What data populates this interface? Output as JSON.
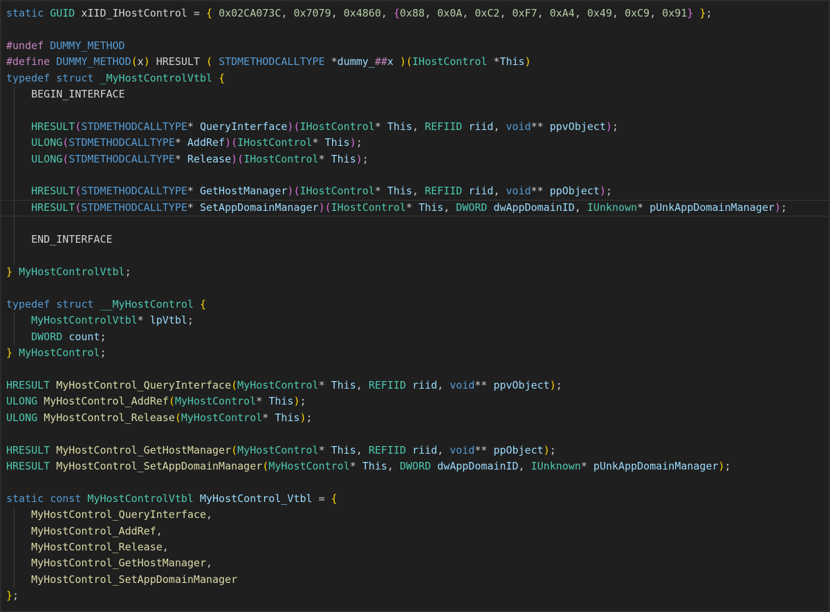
{
  "editor": {
    "theme": "dark",
    "colors": {
      "background": "#1f1f1f",
      "keyword": "#569cd6",
      "preprocessor": "#c586c0",
      "type": "#4ec9b0",
      "function": "#dcdcaa",
      "number": "#b5cea8",
      "variable": "#9cdcfe",
      "bracket_1": "#ffd700",
      "bracket_2": "#da70d6",
      "bracket_3": "#179fff"
    },
    "current_line": 12,
    "lines": [
      [
        [
          "kw",
          "static"
        ],
        [
          "p",
          " "
        ],
        [
          "type",
          "GUID"
        ],
        [
          "p",
          " "
        ],
        [
          "id",
          "xIID_IHostControl"
        ],
        [
          "p",
          " = "
        ],
        [
          "b1",
          "{"
        ],
        [
          "p",
          " "
        ],
        [
          "num",
          "0x02CA073C"
        ],
        [
          "p",
          ", "
        ],
        [
          "num",
          "0x7079"
        ],
        [
          "p",
          ", "
        ],
        [
          "num",
          "0x4860"
        ],
        [
          "p",
          ", "
        ],
        [
          "b2",
          "{"
        ],
        [
          "num",
          "0x88"
        ],
        [
          "p",
          ", "
        ],
        [
          "num",
          "0x0A"
        ],
        [
          "p",
          ", "
        ],
        [
          "num",
          "0xC2"
        ],
        [
          "p",
          ", "
        ],
        [
          "num",
          "0xF7"
        ],
        [
          "p",
          ", "
        ],
        [
          "num",
          "0xA4"
        ],
        [
          "p",
          ", "
        ],
        [
          "num",
          "0x49"
        ],
        [
          "p",
          ", "
        ],
        [
          "num",
          "0xC9"
        ],
        [
          "p",
          ", "
        ],
        [
          "num",
          "0x91"
        ],
        [
          "b2",
          "}"
        ],
        [
          "p",
          " "
        ],
        [
          "b1",
          "}"
        ],
        [
          "p",
          ";"
        ]
      ],
      [],
      [
        [
          "pre",
          "#undef"
        ],
        [
          "p",
          " "
        ],
        [
          "macro",
          "DUMMY_METHOD"
        ]
      ],
      [
        [
          "pre",
          "#define"
        ],
        [
          "p",
          " "
        ],
        [
          "macro",
          "DUMMY_METHOD"
        ],
        [
          "b1",
          "("
        ],
        [
          "id",
          "x"
        ],
        [
          "b1",
          ")"
        ],
        [
          "p",
          " "
        ],
        [
          "id",
          "HRESULT"
        ],
        [
          "p",
          " "
        ],
        [
          "b1",
          "("
        ],
        [
          "p",
          " "
        ],
        [
          "macro",
          "STDMETHODCALLTYPE"
        ],
        [
          "p",
          " *"
        ],
        [
          "var",
          "dummy_"
        ],
        [
          "pre",
          "##"
        ],
        [
          "var",
          "x"
        ],
        [
          "p",
          " "
        ],
        [
          "b1",
          ")"
        ],
        [
          "b1",
          "("
        ],
        [
          "type",
          "IHostControl"
        ],
        [
          "p",
          " *"
        ],
        [
          "var",
          "This"
        ],
        [
          "b1",
          ")"
        ]
      ],
      [
        [
          "kw",
          "typedef"
        ],
        [
          "p",
          " "
        ],
        [
          "kw",
          "struct"
        ],
        [
          "p",
          " "
        ],
        [
          "type",
          "_MyHostControlVtbl"
        ],
        [
          "p",
          " "
        ],
        [
          "b1",
          "{"
        ]
      ],
      [
        [
          "p",
          "    "
        ],
        [
          "id",
          "BEGIN_INTERFACE"
        ]
      ],
      [],
      [
        [
          "p",
          "    "
        ],
        [
          "type",
          "HRESULT"
        ],
        [
          "b2",
          "("
        ],
        [
          "macro",
          "STDMETHODCALLTYPE"
        ],
        [
          "p",
          "* "
        ],
        [
          "var",
          "QueryInterface"
        ],
        [
          "b2",
          ")"
        ],
        [
          "b2",
          "("
        ],
        [
          "type",
          "IHostControl"
        ],
        [
          "p",
          "* "
        ],
        [
          "var",
          "This"
        ],
        [
          "p",
          ", "
        ],
        [
          "type",
          "REFIID"
        ],
        [
          "p",
          " "
        ],
        [
          "var",
          "riid"
        ],
        [
          "p",
          ", "
        ],
        [
          "kw",
          "void"
        ],
        [
          "p",
          "** "
        ],
        [
          "var",
          "ppvObject"
        ],
        [
          "b2",
          ")"
        ],
        [
          "p",
          ";"
        ]
      ],
      [
        [
          "p",
          "    "
        ],
        [
          "type",
          "ULONG"
        ],
        [
          "b2",
          "("
        ],
        [
          "macro",
          "STDMETHODCALLTYPE"
        ],
        [
          "p",
          "* "
        ],
        [
          "var",
          "AddRef"
        ],
        [
          "b2",
          ")"
        ],
        [
          "b2",
          "("
        ],
        [
          "type",
          "IHostControl"
        ],
        [
          "p",
          "* "
        ],
        [
          "var",
          "This"
        ],
        [
          "b2",
          ")"
        ],
        [
          "p",
          ";"
        ]
      ],
      [
        [
          "p",
          "    "
        ],
        [
          "type",
          "ULONG"
        ],
        [
          "b2",
          "("
        ],
        [
          "macro",
          "STDMETHODCALLTYPE"
        ],
        [
          "p",
          "* "
        ],
        [
          "var",
          "Release"
        ],
        [
          "b2",
          ")"
        ],
        [
          "b2",
          "("
        ],
        [
          "type",
          "IHostControl"
        ],
        [
          "p",
          "* "
        ],
        [
          "var",
          "This"
        ],
        [
          "b2",
          ")"
        ],
        [
          "p",
          ";"
        ]
      ],
      [],
      [
        [
          "p",
          "    "
        ],
        [
          "type",
          "HRESULT"
        ],
        [
          "b2",
          "("
        ],
        [
          "macro",
          "STDMETHODCALLTYPE"
        ],
        [
          "p",
          "* "
        ],
        [
          "var",
          "GetHostManager"
        ],
        [
          "b2",
          ")"
        ],
        [
          "b2",
          "("
        ],
        [
          "type",
          "IHostControl"
        ],
        [
          "p",
          "* "
        ],
        [
          "var",
          "This"
        ],
        [
          "p",
          ", "
        ],
        [
          "type",
          "REFIID"
        ],
        [
          "p",
          " "
        ],
        [
          "var",
          "riid"
        ],
        [
          "p",
          ", "
        ],
        [
          "kw",
          "void"
        ],
        [
          "p",
          "** "
        ],
        [
          "var",
          "ppObject"
        ],
        [
          "b2",
          ")"
        ],
        [
          "p",
          ";"
        ]
      ],
      [
        [
          "p",
          "    "
        ],
        [
          "type",
          "HRESULT"
        ],
        [
          "b2",
          "("
        ],
        [
          "macro",
          "STDMETHODCALLTYPE"
        ],
        [
          "p",
          "* "
        ],
        [
          "var",
          "SetAppDomainManager"
        ],
        [
          "b2",
          ")"
        ],
        [
          "b2",
          "("
        ],
        [
          "type",
          "IHostControl"
        ],
        [
          "p",
          "* "
        ],
        [
          "var",
          "This"
        ],
        [
          "p",
          ", "
        ],
        [
          "type",
          "DWORD"
        ],
        [
          "p",
          " "
        ],
        [
          "var",
          "dwAppDomainID"
        ],
        [
          "p",
          ", "
        ],
        [
          "type",
          "IUnknown"
        ],
        [
          "p",
          "* "
        ],
        [
          "var",
          "pUnkAppDomainManager"
        ],
        [
          "b2",
          ")"
        ],
        [
          "p",
          ";"
        ]
      ],
      [],
      [
        [
          "p",
          "    "
        ],
        [
          "id",
          "END_INTERFACE"
        ]
      ],
      [],
      [
        [
          "b1",
          "}"
        ],
        [
          "p",
          " "
        ],
        [
          "type",
          "MyHostControlVtbl"
        ],
        [
          "p",
          ";"
        ]
      ],
      [],
      [
        [
          "kw",
          "typedef"
        ],
        [
          "p",
          " "
        ],
        [
          "kw",
          "struct"
        ],
        [
          "p",
          " "
        ],
        [
          "type",
          "__MyHostControl"
        ],
        [
          "p",
          " "
        ],
        [
          "b1",
          "{"
        ]
      ],
      [
        [
          "p",
          "    "
        ],
        [
          "type",
          "MyHostControlVtbl"
        ],
        [
          "p",
          "* "
        ],
        [
          "var",
          "lpVtbl"
        ],
        [
          "p",
          ";"
        ]
      ],
      [
        [
          "p",
          "    "
        ],
        [
          "type",
          "DWORD"
        ],
        [
          "p",
          " "
        ],
        [
          "var",
          "count"
        ],
        [
          "p",
          ";"
        ]
      ],
      [
        [
          "b1",
          "}"
        ],
        [
          "p",
          " "
        ],
        [
          "type",
          "MyHostControl"
        ],
        [
          "p",
          ";"
        ]
      ],
      [],
      [
        [
          "type",
          "HRESULT"
        ],
        [
          "p",
          " "
        ],
        [
          "fn",
          "MyHostControl_QueryInterface"
        ],
        [
          "b1",
          "("
        ],
        [
          "type",
          "MyHostControl"
        ],
        [
          "p",
          "* "
        ],
        [
          "var",
          "This"
        ],
        [
          "p",
          ", "
        ],
        [
          "type",
          "REFIID"
        ],
        [
          "p",
          " "
        ],
        [
          "var",
          "riid"
        ],
        [
          "p",
          ", "
        ],
        [
          "kw",
          "void"
        ],
        [
          "p",
          "** "
        ],
        [
          "var",
          "ppvObject"
        ],
        [
          "b1",
          ")"
        ],
        [
          "p",
          ";"
        ]
      ],
      [
        [
          "type",
          "ULONG"
        ],
        [
          "p",
          " "
        ],
        [
          "fn",
          "MyHostControl_AddRef"
        ],
        [
          "b1",
          "("
        ],
        [
          "type",
          "MyHostControl"
        ],
        [
          "p",
          "* "
        ],
        [
          "var",
          "This"
        ],
        [
          "b1",
          ")"
        ],
        [
          "p",
          ";"
        ]
      ],
      [
        [
          "type",
          "ULONG"
        ],
        [
          "p",
          " "
        ],
        [
          "fn",
          "MyHostControl_Release"
        ],
        [
          "b1",
          "("
        ],
        [
          "type",
          "MyHostControl"
        ],
        [
          "p",
          "* "
        ],
        [
          "var",
          "This"
        ],
        [
          "b1",
          ")"
        ],
        [
          "p",
          ";"
        ]
      ],
      [],
      [
        [
          "type",
          "HRESULT"
        ],
        [
          "p",
          " "
        ],
        [
          "fn",
          "MyHostControl_GetHostManager"
        ],
        [
          "b1",
          "("
        ],
        [
          "type",
          "MyHostControl"
        ],
        [
          "p",
          "* "
        ],
        [
          "var",
          "This"
        ],
        [
          "p",
          ", "
        ],
        [
          "type",
          "REFIID"
        ],
        [
          "p",
          " "
        ],
        [
          "var",
          "riid"
        ],
        [
          "p",
          ", "
        ],
        [
          "kw",
          "void"
        ],
        [
          "p",
          "** "
        ],
        [
          "var",
          "ppObject"
        ],
        [
          "b1",
          ")"
        ],
        [
          "p",
          ";"
        ]
      ],
      [
        [
          "type",
          "HRESULT"
        ],
        [
          "p",
          " "
        ],
        [
          "fn",
          "MyHostControl_SetAppDomainManager"
        ],
        [
          "b1",
          "("
        ],
        [
          "type",
          "MyHostControl"
        ],
        [
          "p",
          "* "
        ],
        [
          "var",
          "This"
        ],
        [
          "p",
          ", "
        ],
        [
          "type",
          "DWORD"
        ],
        [
          "p",
          " "
        ],
        [
          "var",
          "dwAppDomainID"
        ],
        [
          "p",
          ", "
        ],
        [
          "type",
          "IUnknown"
        ],
        [
          "p",
          "* "
        ],
        [
          "var",
          "pUnkAppDomainManager"
        ],
        [
          "b1",
          ")"
        ],
        [
          "p",
          ";"
        ]
      ],
      [],
      [
        [
          "kw",
          "static"
        ],
        [
          "p",
          " "
        ],
        [
          "kw",
          "const"
        ],
        [
          "p",
          " "
        ],
        [
          "type",
          "MyHostControlVtbl"
        ],
        [
          "p",
          " "
        ],
        [
          "var",
          "MyHostControl_Vtbl"
        ],
        [
          "p",
          " = "
        ],
        [
          "b1",
          "{"
        ]
      ],
      [
        [
          "p",
          "    "
        ],
        [
          "fn",
          "MyHostControl_QueryInterface"
        ],
        [
          "p",
          ","
        ]
      ],
      [
        [
          "p",
          "    "
        ],
        [
          "fn",
          "MyHostControl_AddRef"
        ],
        [
          "p",
          ","
        ]
      ],
      [
        [
          "p",
          "    "
        ],
        [
          "fn",
          "MyHostControl_Release"
        ],
        [
          "p",
          ","
        ]
      ],
      [
        [
          "p",
          "    "
        ],
        [
          "fn",
          "MyHostControl_GetHostManager"
        ],
        [
          "p",
          ","
        ]
      ],
      [
        [
          "p",
          "    "
        ],
        [
          "fn",
          "MyHostControl_SetAppDomainManager"
        ]
      ],
      [
        [
          "b1",
          "}"
        ],
        [
          "p",
          ";"
        ]
      ]
    ]
  }
}
